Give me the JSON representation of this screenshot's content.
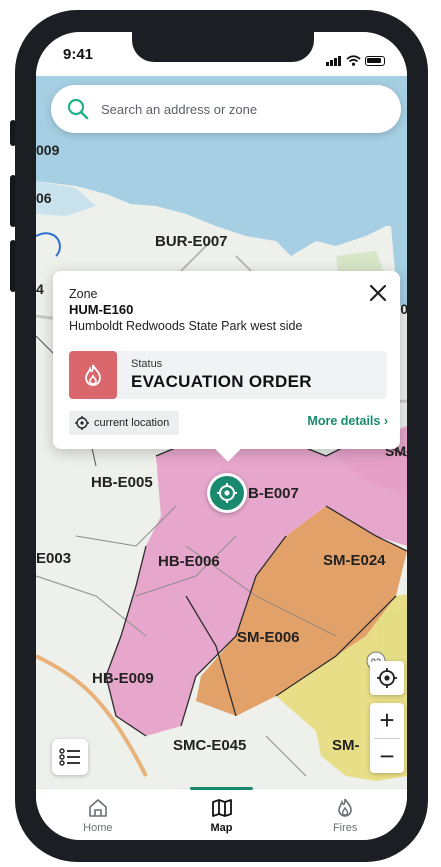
{
  "status_bar": {
    "time": "9:41"
  },
  "search": {
    "placeholder": "Search an address or zone"
  },
  "popup": {
    "zone_label": "Zone",
    "zone_id": "HUM-E160",
    "zone_description": "Humboldt Redwoods State Park west side",
    "status_label": "Status",
    "status_value": "EVACUATION ORDER",
    "current_location_label": "current location",
    "more_details_label": "More details ›"
  },
  "map": {
    "zone_labels": [
      "009",
      "06",
      "BUR-E007",
      "4",
      "E02",
      "SM-",
      "HB-E005",
      "B-E007",
      "E003",
      "HB-E006",
      "SM-E024",
      "SM-E006",
      "HB-E009",
      "E0",
      "SMC-E045",
      "SM-"
    ],
    "route_badge": "92",
    "colors": {
      "water": "#a6cfe3",
      "order_zone": "#e6a0c8",
      "warning_orange": "#e29a5e",
      "advisory_yellow": "#e7dc7c",
      "land": "#eef0ec"
    }
  },
  "controls": {
    "locate_icon": "crosshair-icon",
    "zoom_in": "+",
    "zoom_out": "−",
    "legend_icon": "list-icon"
  },
  "tabbar": {
    "tabs": [
      {
        "label": "Home",
        "icon": "home-icon",
        "active": false
      },
      {
        "label": "Map",
        "icon": "map-icon",
        "active": true
      },
      {
        "label": "Fires",
        "icon": "flame-icon",
        "active": false
      }
    ]
  },
  "accent_color": "#1a8a6e"
}
